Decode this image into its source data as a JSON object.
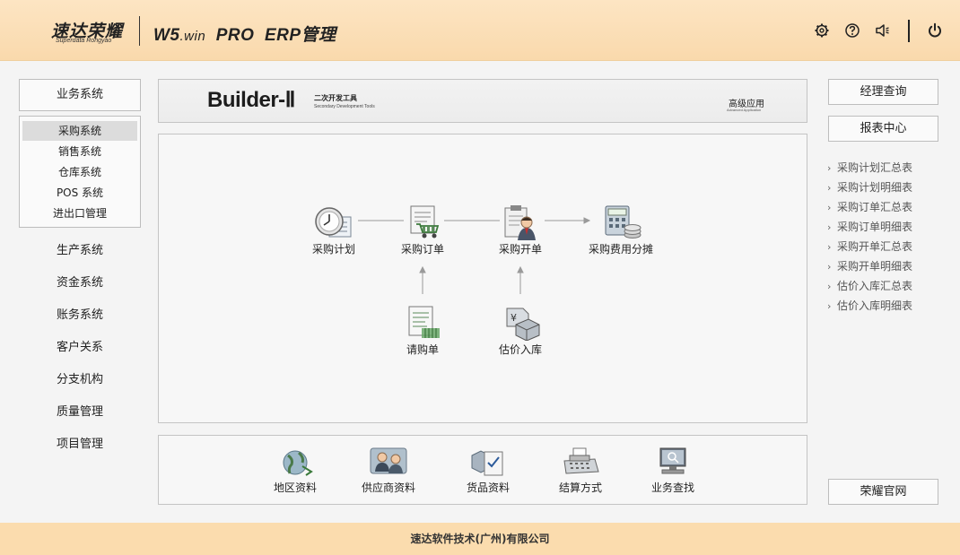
{
  "header": {
    "logo_cn": "速达荣耀",
    "logo_en": "Superdata Rongyao",
    "title_main": "W5",
    "title_dot": ".win",
    "title_rest": "PRO  ERP管理",
    "icons": [
      "gear-icon",
      "help-icon",
      "speaker-icon",
      "power-icon"
    ]
  },
  "left_nav": {
    "top_button": "业务系统",
    "sub_items": [
      "采购系统",
      "销售系统",
      "仓库系统",
      "POS 系统",
      "进出口管理"
    ],
    "active_sub_index": 0,
    "links": [
      "生产系统",
      "资金系统",
      "账务系统",
      "客户关系",
      "分支机构",
      "质量管理",
      "项目管理"
    ]
  },
  "banner": {
    "title": "Builder-Ⅱ",
    "subtitle_cn": "二次开发工具",
    "subtitle_en": "Secondary Development Tools",
    "right_cn": "高级应用",
    "right_en": "Advanced Application"
  },
  "flow": {
    "purchase_plan": "采购计划",
    "purchase_order": "采购订单",
    "purchase_invoice": "采购开单",
    "cost_allocation": "采购费用分摊",
    "purchase_request": "请购单",
    "estimated_stock_in": "估价入库"
  },
  "toolbar": {
    "region": "地区资料",
    "supplier": "供应商资料",
    "goods": "货品资料",
    "settlement": "结算方式",
    "business_search": "业务查找"
  },
  "right_panel": {
    "manager_query": "经理查询",
    "report_center": "报表中心",
    "reports": [
      "采购计划汇总表",
      "采购计划明细表",
      "采购订单汇总表",
      "采购订单明细表",
      "采购开单汇总表",
      "采购开单明细表",
      "估价入库汇总表",
      "估价入库明细表"
    ],
    "official_site": "荣耀官网"
  },
  "footer": {
    "company": "速达软件技术(广州)有限公司"
  },
  "colors": {
    "header_bg": "#fbdcae",
    "footer_bg": "#fbdcae",
    "active_item_bg": "#dcdcdc"
  }
}
